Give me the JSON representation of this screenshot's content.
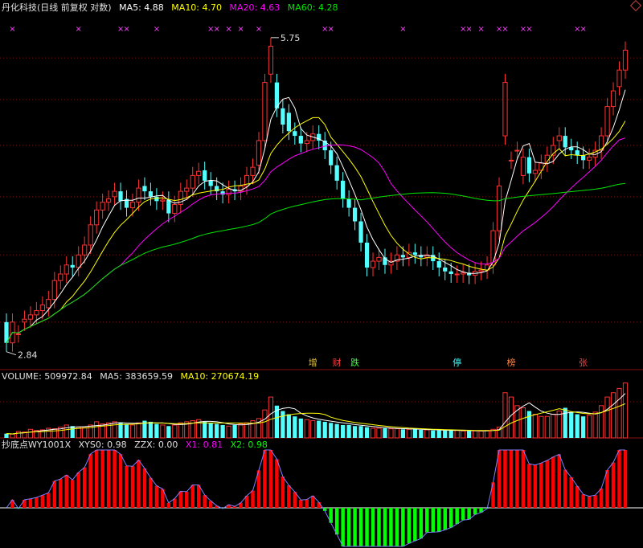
{
  "header": {
    "title": "丹化科技(日线 前复权 对数)",
    "ma5": "MA5: 4.88",
    "ma10": "MA10: 4.70",
    "ma20": "MA20: 4.63",
    "ma60": "MA60: 4.28",
    "max_price": "5.75",
    "min_price": "2.84"
  },
  "volume_header": {
    "volume": "VOLUME: 509972.84",
    "ma5": "MA5: 383659.59",
    "ma10": "MA10: 270674.19"
  },
  "indicator_header": {
    "name": "抄底点WY1001X",
    "xys0": "XYS0: 0.98",
    "zzx": "ZZX: 0.00",
    "x1": "X1: 0.81",
    "x2": "X2: 0.98"
  },
  "markers": [
    "增",
    "财",
    "跌",
    "停",
    "榜",
    "张"
  ],
  "colors": {
    "background": "#000000",
    "up": "#ff3232",
    "down": "#54ffff",
    "ma5": "#ffffff",
    "ma10": "#ffff00",
    "ma20": "#ff00ff",
    "ma60": "#00e600",
    "indicator_pos": "#ff0000",
    "indicator_neg": "#00ff00",
    "indicator_blue": "#0000ff",
    "indicator_cyan": "#00ffff"
  },
  "chart_data": [
    {
      "type": "candlestick",
      "title": "丹化科技(日线 前复权 对数)",
      "ylim": [
        2.75,
        6.0
      ],
      "x": [
        1,
        2,
        3,
        4,
        5,
        6,
        7,
        8,
        9,
        10,
        11,
        12,
        13,
        14,
        15,
        16,
        17,
        18,
        19,
        20,
        21,
        22,
        23,
        24,
        25,
        26,
        27,
        28,
        29,
        30,
        31,
        32,
        33,
        34,
        35,
        36,
        37,
        38,
        39,
        40,
        41,
        42,
        43,
        44,
        45,
        46,
        47,
        48,
        49,
        50,
        51,
        52,
        53,
        54,
        55,
        56,
        57,
        58,
        59,
        60,
        61,
        62,
        63,
        64,
        65,
        66,
        67,
        68,
        69,
        70,
        71,
        72,
        73,
        74,
        75,
        76,
        77,
        78,
        79,
        80,
        81,
        82,
        83,
        84,
        85,
        86,
        87,
        88,
        89,
        90,
        91,
        92,
        93,
        94,
        95,
        96,
        97,
        98,
        99,
        100,
        101,
        102,
        103,
        104,
        105,
        106,
        107,
        108,
        109,
        110,
        111,
        112,
        113,
        114,
        115,
        116,
        117,
        118,
        119,
        120,
        121,
        122,
        123,
        124,
        125,
        126,
        127,
        128
      ],
      "open": [
        3.0,
        2.86,
        2.92,
        3.0,
        3.02,
        3.05,
        3.08,
        3.1,
        3.16,
        3.3,
        3.35,
        3.42,
        3.4,
        3.5,
        3.58,
        3.75,
        3.88,
        3.95,
        4.0,
        4.05,
        3.98,
        3.9,
        3.95,
        4.1,
        4.05,
        4.0,
        3.96,
        3.97,
        3.85,
        3.93,
        4.05,
        4.08,
        4.2,
        4.25,
        4.15,
        4.1,
        4.05,
        4.02,
        4.07,
        4.05,
        4.1,
        4.2,
        4.3,
        4.55,
        5.3,
        5.2,
        4.9,
        4.85,
        4.65,
        4.6,
        4.52,
        4.55,
        4.62,
        4.55,
        4.45,
        4.3,
        4.15,
        3.98,
        3.9,
        3.78,
        3.6,
        3.4,
        3.45,
        3.48,
        3.42,
        3.45,
        3.5,
        3.48,
        3.52,
        3.5,
        3.48,
        3.5,
        3.45,
        3.4,
        3.37,
        3.35,
        3.35,
        3.36,
        3.34,
        3.37,
        3.38,
        3.42,
        3.7,
        4.6,
        4.35,
        4.45,
        4.2,
        4.38,
        4.22,
        4.25,
        4.32,
        4.4,
        4.55,
        4.6,
        4.48,
        4.45,
        4.4,
        4.35,
        4.38,
        4.45,
        4.6,
        4.92,
        5.15,
        5.35
      ],
      "close": [
        2.86,
        3.0,
        2.92,
        3.02,
        3.05,
        3.08,
        3.12,
        3.16,
        3.3,
        3.35,
        3.42,
        3.4,
        3.5,
        3.58,
        3.75,
        3.88,
        3.95,
        3.98,
        4.05,
        3.96,
        3.9,
        3.95,
        4.08,
        4.05,
        4.0,
        3.96,
        3.97,
        3.85,
        3.93,
        4.05,
        4.08,
        4.2,
        4.24,
        4.15,
        4.1,
        4.05,
        4.02,
        4.07,
        4.05,
        4.1,
        4.2,
        4.28,
        4.55,
        5.2,
        5.65,
        4.9,
        4.72,
        4.65,
        4.6,
        4.52,
        4.55,
        4.62,
        4.55,
        4.45,
        4.3,
        4.15,
        3.98,
        3.9,
        3.78,
        3.6,
        3.4,
        3.45,
        3.48,
        3.42,
        3.45,
        3.5,
        3.48,
        3.52,
        3.5,
        3.48,
        3.5,
        3.45,
        3.4,
        3.37,
        3.35,
        3.35,
        3.36,
        3.34,
        3.37,
        3.38,
        3.42,
        3.7,
        4.1,
        5.2,
        4.35,
        4.45,
        4.38,
        4.22,
        4.25,
        4.32,
        4.4,
        4.5,
        4.6,
        4.48,
        4.45,
        4.4,
        4.35,
        4.38,
        4.45,
        4.6,
        4.92,
        5.1,
        5.35,
        5.6
      ]
    },
    {
      "type": "bar",
      "title": "VOLUME",
      "ylim": [
        0,
        560000
      ],
      "values": [
        40000,
        35000,
        60000,
        55000,
        80000,
        70000,
        75000,
        90000,
        85000,
        100000,
        120000,
        110000,
        100000,
        95000,
        120000,
        150000,
        130000,
        140000,
        150000,
        140000,
        130000,
        120000,
        140000,
        160000,
        150000,
        130000,
        120000,
        110000,
        120000,
        140000,
        150000,
        160000,
        170000,
        150000,
        140000,
        130000,
        120000,
        110000,
        120000,
        130000,
        140000,
        160000,
        180000,
        260000,
        380000,
        300000,
        250000,
        220000,
        200000,
        180000,
        170000,
        160000,
        160000,
        150000,
        140000,
        130000,
        120000,
        120000,
        110000,
        110000,
        100000,
        90000,
        90000,
        90000,
        85000,
        85000,
        80000,
        80000,
        80000,
        75000,
        75000,
        70000,
        70000,
        70000,
        70000,
        70000,
        65000,
        65000,
        65000,
        65000,
        70000,
        80000,
        100000,
        420000,
        380000,
        300000,
        280000,
        250000,
        220000,
        200000,
        200000,
        220000,
        250000,
        280000,
        240000,
        220000,
        200000,
        210000,
        240000,
        300000,
        380000,
        420000,
        460000,
        510000
      ]
    },
    {
      "type": "bar",
      "title": "抄底点WY1001X",
      "ylim": [
        -0.9,
        1.2
      ]
    }
  ]
}
